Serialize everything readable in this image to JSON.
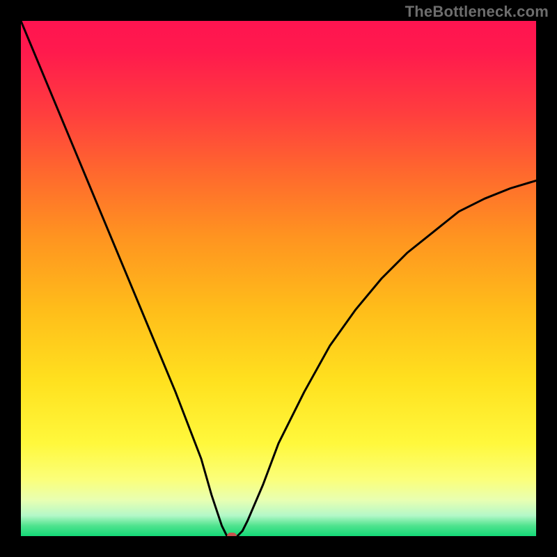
{
  "watermark": {
    "text": "TheBottleneck.com"
  },
  "colors": {
    "curve": "#000000",
    "marker": "#c9524f",
    "frame_bg": "#000000",
    "watermark": "#6d6d6d"
  },
  "chart_data": {
    "type": "line",
    "title": "",
    "xlabel": "",
    "ylabel": "",
    "xlim": [
      0,
      100
    ],
    "ylim": [
      0,
      100
    ],
    "grid": false,
    "legend": false,
    "series": [
      {
        "name": "bottleneck-curve",
        "x": [
          0,
          5,
          10,
          15,
          20,
          25,
          30,
          35,
          37,
          39,
          40,
          41,
          42,
          43,
          44,
          47,
          50,
          55,
          60,
          65,
          70,
          75,
          80,
          85,
          90,
          95,
          100
        ],
        "y": [
          100,
          88,
          76,
          64,
          52,
          40,
          28,
          15,
          8,
          2,
          0,
          0,
          0,
          1,
          3,
          10,
          18,
          28,
          37,
          44,
          50,
          55,
          59,
          63,
          65.5,
          67.5,
          69
        ]
      }
    ],
    "annotations": [
      {
        "name": "optimal-marker",
        "x": 41,
        "y": 0
      }
    ]
  }
}
